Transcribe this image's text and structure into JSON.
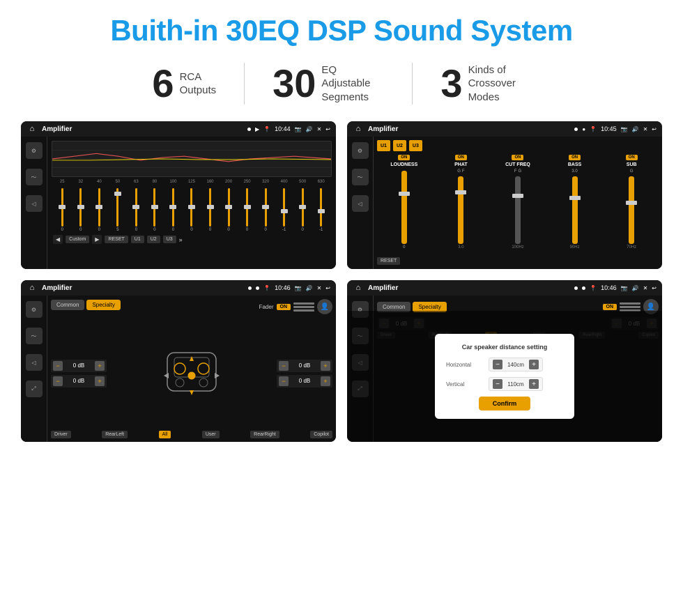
{
  "page": {
    "title": "Buith-in 30EQ DSP Sound System"
  },
  "stats": [
    {
      "number": "6",
      "label": "RCA\nOutputs"
    },
    {
      "number": "30",
      "label": "EQ Adjustable\nSegments"
    },
    {
      "number": "3",
      "label": "Kinds of\nCrossover Modes"
    }
  ],
  "screen1": {
    "statusBar": {
      "title": "Amplifier",
      "time": "10:44"
    },
    "freqLabels": [
      "25",
      "32",
      "40",
      "50",
      "63",
      "80",
      "100",
      "125",
      "160",
      "200",
      "250",
      "320",
      "400",
      "500",
      "630"
    ],
    "sliderValues": [
      "0",
      "0",
      "0",
      "5",
      "0",
      "0",
      "0",
      "0",
      "0",
      "0",
      "0",
      "0",
      "0",
      "-1",
      "0",
      "-1"
    ],
    "buttons": [
      "Custom",
      "RESET",
      "U1",
      "U2",
      "U3"
    ]
  },
  "screen2": {
    "statusBar": {
      "title": "Amplifier",
      "time": "10:45"
    },
    "presets": [
      "U1",
      "U2",
      "U3"
    ],
    "columns": [
      {
        "title": "LOUDNESS",
        "on": true
      },
      {
        "title": "PHAT",
        "on": true
      },
      {
        "title": "CUT FREQ",
        "on": true
      },
      {
        "title": "BASS",
        "on": true
      },
      {
        "title": "SUB",
        "on": true
      }
    ],
    "buttons": [
      "RESET"
    ]
  },
  "screen3": {
    "statusBar": {
      "title": "Amplifier",
      "time": "10:46"
    },
    "tabs": [
      "Common",
      "Specialty"
    ],
    "faderLabel": "Fader",
    "faderOn": "ON",
    "dbValues": [
      "0 dB",
      "0 dB",
      "0 dB",
      "0 dB"
    ],
    "bottomButtons": [
      "Driver",
      "RearLeft",
      "All",
      "User",
      "RearRight",
      "Copilot"
    ]
  },
  "screen4": {
    "statusBar": {
      "title": "Amplifier",
      "time": "10:46"
    },
    "tabs": [
      "Common",
      "Specialty"
    ],
    "dialog": {
      "title": "Car speaker distance setting",
      "horizontal": {
        "label": "Horizontal",
        "value": "140cm"
      },
      "vertical": {
        "label": "Vertical",
        "value": "110cm"
      },
      "confirmLabel": "Confirm"
    },
    "dbValues": [
      "0 dB",
      "0 dB"
    ],
    "bottomButtons": [
      "Driver",
      "RearLeft",
      "All",
      "User",
      "RearRight",
      "Copilot"
    ]
  },
  "colors": {
    "accent": "#e8a000",
    "titleBlue": "#1a9be8",
    "screenBg": "#111111",
    "statusBg": "#1a1a1a"
  }
}
